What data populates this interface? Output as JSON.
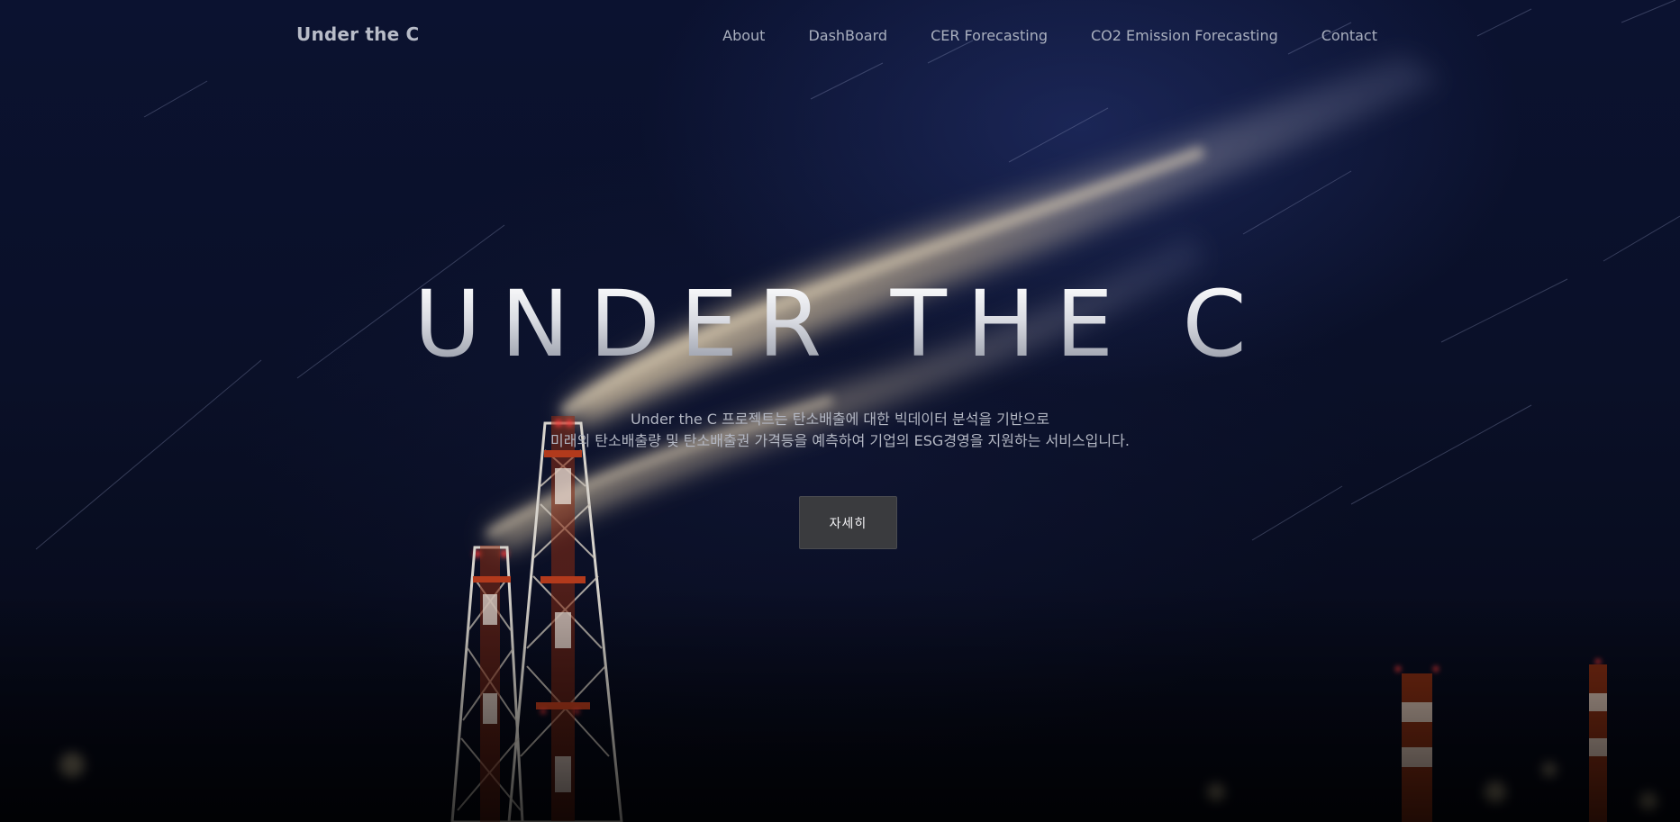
{
  "navbar": {
    "brand": "Under the C",
    "links": [
      {
        "label": "About"
      },
      {
        "label": "DashBoard"
      },
      {
        "label": "CER Forecasting"
      },
      {
        "label": "CO2 Emission Forecasting"
      },
      {
        "label": "Contact"
      }
    ]
  },
  "hero": {
    "title": "UNDER THE C",
    "description_lines": [
      "Under the C 프로젝트는 탄소배출에 대한 빅데이터 분석을 기반으로",
      "미래의 탄소배출량 및 탄소배출권 가격등을 예측하여 기업의 ESG경영을 지원하는 서비스입니다."
    ],
    "cta_label": "자세히"
  },
  "colors": {
    "background": "#0a1026",
    "nav_text": "#aab0bf",
    "button_bg": "#3a3b3e",
    "chimney_red": "#b23a1c",
    "smoke": "#d8c9a8"
  }
}
